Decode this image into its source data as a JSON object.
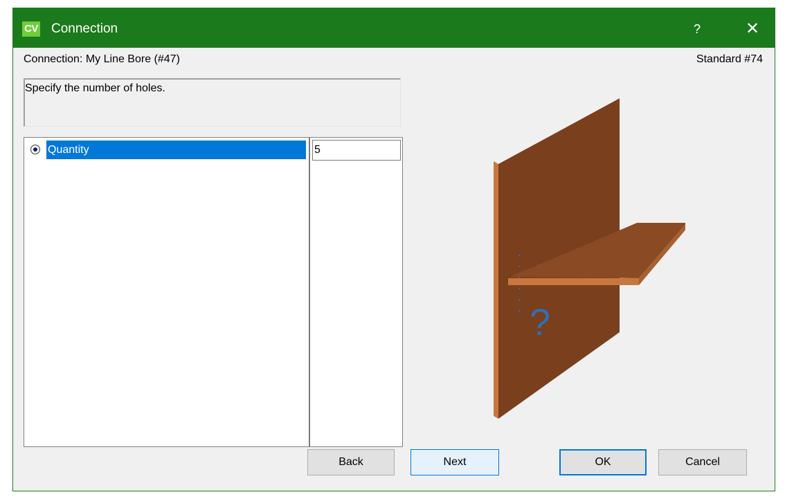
{
  "window": {
    "app_icon_text": "CV",
    "title": "Connection",
    "help_glyph": "?",
    "close_glyph": "✕"
  },
  "header": {
    "connection_label": "Connection: My Line Bore (#47)",
    "standard_label": "Standard #74"
  },
  "description": "Specify the number of holes.",
  "properties": [
    {
      "name": "Quantity",
      "value": "5",
      "selected": true
    }
  ],
  "illustration": {
    "question_mark": "?",
    "panel_color": "#7a3f1d",
    "shelf_color": "#8a4a23",
    "accent_color": "#2f6fb8"
  },
  "buttons": {
    "back": "Back",
    "next": "Next",
    "ok": "OK",
    "cancel": "Cancel"
  },
  "colors": {
    "titlebar": "#1b7a1b",
    "selection": "#0078d7"
  }
}
